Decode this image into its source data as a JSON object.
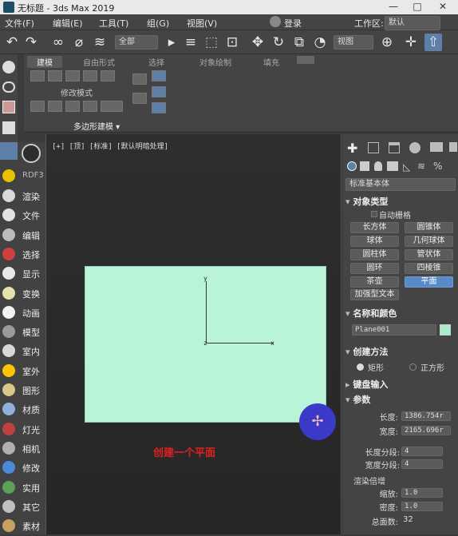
{
  "window": {
    "title": "无标题 - 3ds Max 2019",
    "min": "—",
    "max": "□",
    "close": "✕"
  },
  "menu": {
    "items": [
      "文件(F)",
      "编辑(E)",
      "工具(T)",
      "组(G)",
      "视图(V)"
    ],
    "login": "登录",
    "workspace_label": "工作区:",
    "workspace_value": "默认"
  },
  "toolbar": {
    "selection_filter": "全部",
    "view_dropdown": "视图"
  },
  "ribbon": {
    "tabs": [
      "建模",
      "自由形式",
      "选择",
      "对象绘制",
      "填充"
    ],
    "group_label": "修改模式",
    "footer": "多边形建模"
  },
  "viewport": {
    "label": "[+] [顶] [标准] [默认明暗处理]",
    "axis_y": "y",
    "axis_x": "x",
    "caption": "创建一个平面"
  },
  "left_panel": {
    "top_label": "RDF3",
    "items": [
      "渲染",
      "文件",
      "编辑",
      "选择",
      "显示",
      "变换",
      "动画",
      "模型",
      "室内",
      "室外",
      "图形",
      "材质",
      "灯光",
      "相机",
      "修改",
      "实用",
      "其它",
      "素材"
    ],
    "colors": [
      "#d9d9d9",
      "#e2e2e2",
      "#bbbbbb",
      "#d04040",
      "#e7e7e7",
      "#e9e0b0",
      "#f2f2f2",
      "#9a9a9a",
      "#d8d8d8",
      "#ffc400",
      "#d9c78a",
      "#8fb0d8",
      "#c04040",
      "#b0b0b0",
      "#4a8ad8",
      "#5aa05a",
      "#c0c0c0",
      "#c8a060"
    ]
  },
  "command_panel": {
    "category": "标准基本体",
    "object_type_header": "对象类型",
    "autogrid": "自动栅格",
    "object_buttons": [
      "长方体",
      "圆锥体",
      "球体",
      "几何球体",
      "圆柱体",
      "管状体",
      "圆环",
      "四棱锥",
      "茶壶",
      "平面"
    ],
    "selected_button": "平面",
    "enhanced_text": "加强型文本",
    "name_color_header": "名称和颜色",
    "object_name": "Plane001",
    "object_color": "#a9ecca",
    "creation_method_header": "创建方法",
    "method_rect": "矩形",
    "method_square": "正方形",
    "keyboard_header": "键盘输入",
    "params_header": "参数",
    "length_label": "长度:",
    "length_value": "1386.754r",
    "width_label": "宽度:",
    "width_value": "2165.696r",
    "length_segs_label": "长度分段:",
    "length_segs_value": "4",
    "width_segs_label": "宽度分段:",
    "width_segs_value": "4",
    "render_mult_label": "渲染倍增",
    "scale_label": "缩放:",
    "scale_value": "1.0",
    "density_label": "密度:",
    "density_value": "1.0",
    "total_faces_label": "总面数:",
    "total_faces_value": "32"
  }
}
